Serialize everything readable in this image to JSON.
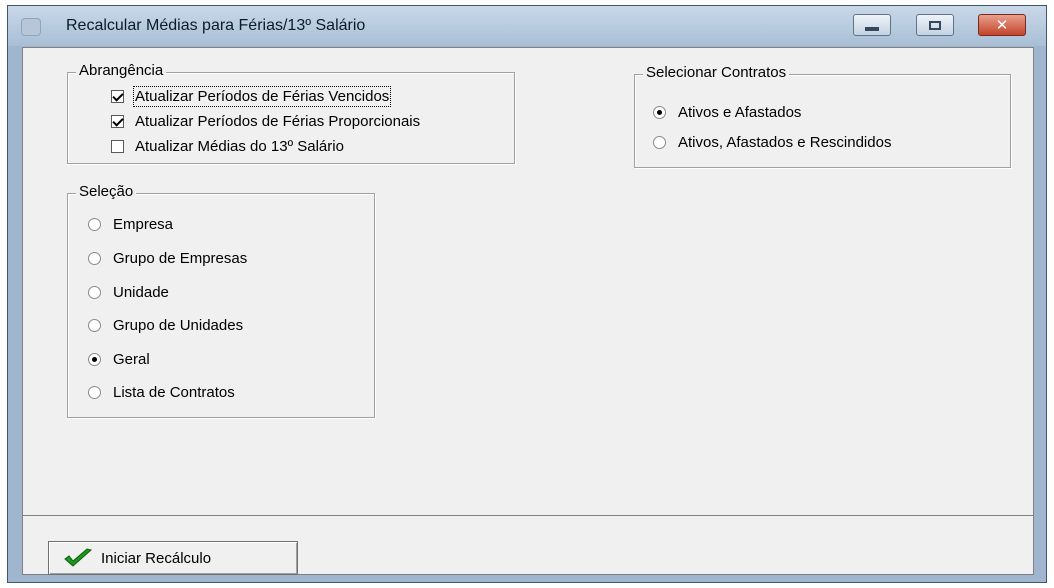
{
  "window": {
    "title": "Recalcular Médias para Férias/13º Salário"
  },
  "icons": {
    "minimize": "minimize-icon",
    "maximize": "maximize-icon",
    "close": "close-icon",
    "start": "checkmark-icon"
  },
  "abrangencia": {
    "title": "Abrangência",
    "items": [
      {
        "label": "Atualizar Períodos de Férias Vencidos",
        "checked": true
      },
      {
        "label": "Atualizar Períodos de Férias Proporcionais",
        "checked": true
      },
      {
        "label": "Atualizar Médias do 13º Salário",
        "checked": false
      }
    ]
  },
  "contratos": {
    "title": "Selecionar Contratos",
    "options": [
      {
        "label": "Ativos e Afastados",
        "selected": true
      },
      {
        "label": "Ativos, Afastados e Rescindidos",
        "selected": false
      }
    ]
  },
  "selecao": {
    "title": "Seleção",
    "options": [
      {
        "label": "Empresa",
        "selected": false
      },
      {
        "label": "Grupo de Empresas",
        "selected": false
      },
      {
        "label": "Unidade",
        "selected": false
      },
      {
        "label": "Grupo de Unidades",
        "selected": false
      },
      {
        "label": "Geral",
        "selected": true
      },
      {
        "label": "Lista de Contratos",
        "selected": false
      }
    ]
  },
  "actions": {
    "start_label": "Iniciar Recálculo"
  },
  "colors": {
    "checkmark": "#1a9a1a"
  }
}
